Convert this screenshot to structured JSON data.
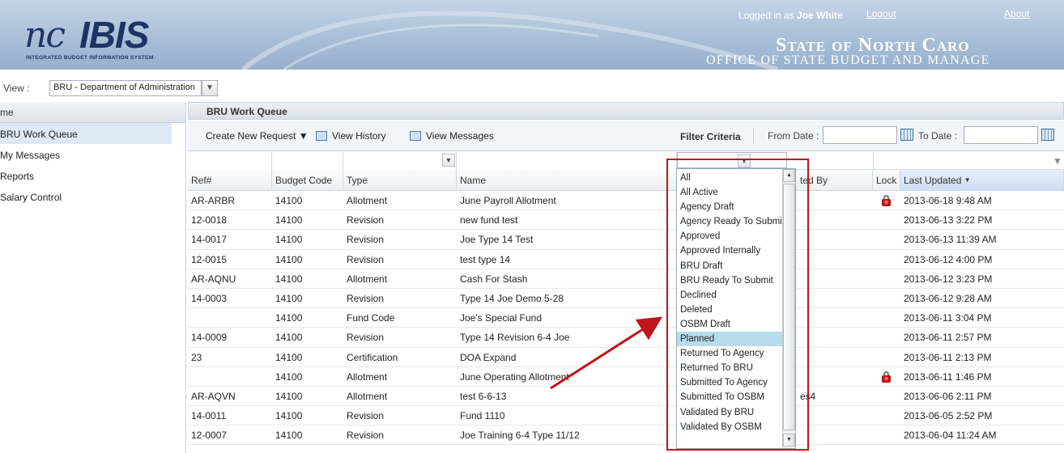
{
  "header": {
    "logo_nc": "nc",
    "logo_ibis": "IBIS",
    "logo_subtitle": "INTEGRATED BUDGET INFORMATION SYSTEM",
    "login_prefix": "Logged in as",
    "user_name": "Joe White",
    "logout": "Logout",
    "about": "About",
    "state_title": "State of North Caro",
    "office_title": "OFFICE OF STATE BUDGET AND MANAGE"
  },
  "viewbar": {
    "label": "View :",
    "selected": "BRU - Department of Administration"
  },
  "leftnav": {
    "home": "me",
    "items": [
      {
        "label": "BRU Work Queue",
        "active": true
      },
      {
        "label": "My Messages"
      },
      {
        "label": "Reports"
      },
      {
        "label": "Salary Control"
      }
    ]
  },
  "panel": {
    "title": "BRU Work Queue"
  },
  "toolbar": {
    "create": "Create New Request ▼",
    "history": "View History",
    "messages": "View Messages",
    "filter_criteria": "Filter Criteria",
    "from_date": "From Date :",
    "to_date": "To Date :"
  },
  "table": {
    "headers": [
      "Ref#",
      "Budget Code",
      "Type",
      "Name",
      "ted By",
      "Lock",
      "Last Updated"
    ],
    "rows": [
      {
        "ref": "AR-ARBR",
        "code": "14100",
        "type": "Allotment",
        "name": "June Payroll Allotment",
        "by": "",
        "lock": true,
        "updated": "2013-06-18 9:48 AM"
      },
      {
        "ref": "12-0018",
        "code": "14100",
        "type": "Revision",
        "name": "new fund test",
        "by": "",
        "lock": false,
        "updated": "2013-06-13 3:22 PM"
      },
      {
        "ref": "14-0017",
        "code": "14100",
        "type": "Revision",
        "name": "Joe Type 14 Test",
        "by": "",
        "lock": false,
        "updated": "2013-06-13 11:39 AM"
      },
      {
        "ref": "12-0015",
        "code": "14100",
        "type": "Revision",
        "name": "test type 14",
        "by": "",
        "lock": false,
        "updated": "2013-06-12 4:00 PM"
      },
      {
        "ref": "AR-AQNU",
        "code": "14100",
        "type": "Allotment",
        "name": "Cash For Stash",
        "by": "",
        "lock": false,
        "updated": "2013-06-12 3:23 PM"
      },
      {
        "ref": "14-0003",
        "code": "14100",
        "type": "Revision",
        "name": "Type 14 Joe Demo 5-28",
        "by": "",
        "lock": false,
        "updated": "2013-06-12 9:28 AM"
      },
      {
        "ref": "",
        "code": "14100",
        "type": "Fund Code",
        "name": "Joe's Special Fund",
        "by": "",
        "lock": false,
        "updated": "2013-06-11 3:04 PM"
      },
      {
        "ref": "14-0009",
        "code": "14100",
        "type": "Revision",
        "name": "Type 14 Revision 6-4 Joe",
        "by": "",
        "lock": false,
        "updated": "2013-06-11 2:57 PM"
      },
      {
        "ref": "23",
        "code": "14100",
        "type": "Certification",
        "name": "DOA Expand",
        "by": "",
        "lock": false,
        "updated": "2013-06-11 2:13 PM"
      },
      {
        "ref": "",
        "code": "14100",
        "type": "Allotment",
        "name": "June Operating Allotment",
        "by": "",
        "lock": true,
        "updated": "2013-06-11 1:46 PM"
      },
      {
        "ref": "AR-AQVN",
        "code": "14100",
        "type": "Allotment",
        "name": "test 6-6-13",
        "by": "es4",
        "lock": false,
        "updated": "2013-06-06 2:11 PM"
      },
      {
        "ref": "14-0011",
        "code": "14100",
        "type": "Revision",
        "name": "Fund 1110",
        "by": "",
        "lock": false,
        "updated": "2013-06-05 2:52 PM"
      },
      {
        "ref": "12-0007",
        "code": "14100",
        "type": "Revision",
        "name": "Joe Training 6-4 Type 11/12",
        "by": "",
        "lock": false,
        "updated": "2013-06-04 11:24 AM"
      }
    ]
  },
  "status_dropdown": {
    "options": [
      "All",
      "All Active",
      "Agency Draft",
      "Agency Ready To Submit",
      "Approved",
      "Approved Internally",
      "BRU Draft",
      "BRU Ready To Submit",
      "Declined",
      "Deleted",
      "OSBM Draft",
      "Planned",
      "Returned To Agency",
      "Returned To BRU",
      "Submitted To Agency",
      "Submitted To OSBM",
      "Validated By BRU",
      "Validated By OSBM"
    ],
    "selected": "Planned"
  },
  "colors": {
    "highlight": "#c0141c",
    "header_bg": "#a9bfd8",
    "selected_option": "#b7dcec"
  }
}
